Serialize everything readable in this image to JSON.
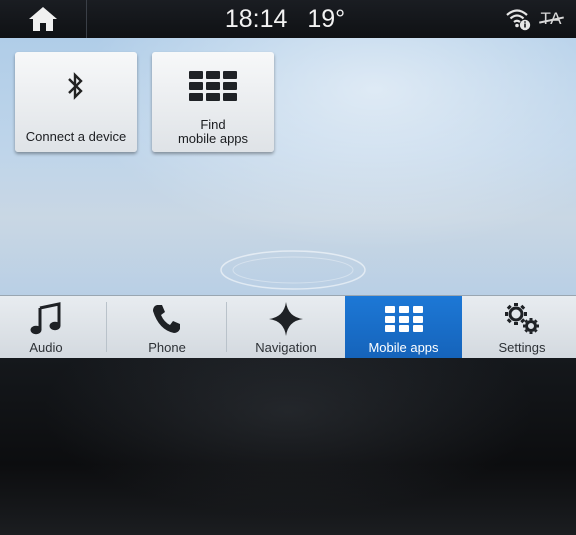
{
  "status": {
    "time": "18:14",
    "temperature": "19°",
    "ta_label": "TA",
    "icons": {
      "home": "home-icon",
      "wifi": "wifi-info-icon"
    }
  },
  "tiles": [
    {
      "label": "Connect a device",
      "icon": "bluetooth-icon"
    },
    {
      "label_line1": "Find",
      "label_line2": "mobile apps",
      "icon": "app-grid-icon"
    }
  ],
  "nav": {
    "items": [
      {
        "label": "Audio",
        "icon": "music-note-icon"
      },
      {
        "label": "Phone",
        "icon": "phone-icon"
      },
      {
        "label": "Navigation",
        "icon": "star-compass-icon"
      },
      {
        "label": "Mobile apps",
        "icon": "app-grid-icon",
        "active": true
      },
      {
        "label": "Settings",
        "icon": "gears-icon"
      }
    ]
  },
  "colors": {
    "active_tab": "#1d78d6",
    "status_bar": "#14171b",
    "content_bg": "#bcd3ea"
  }
}
